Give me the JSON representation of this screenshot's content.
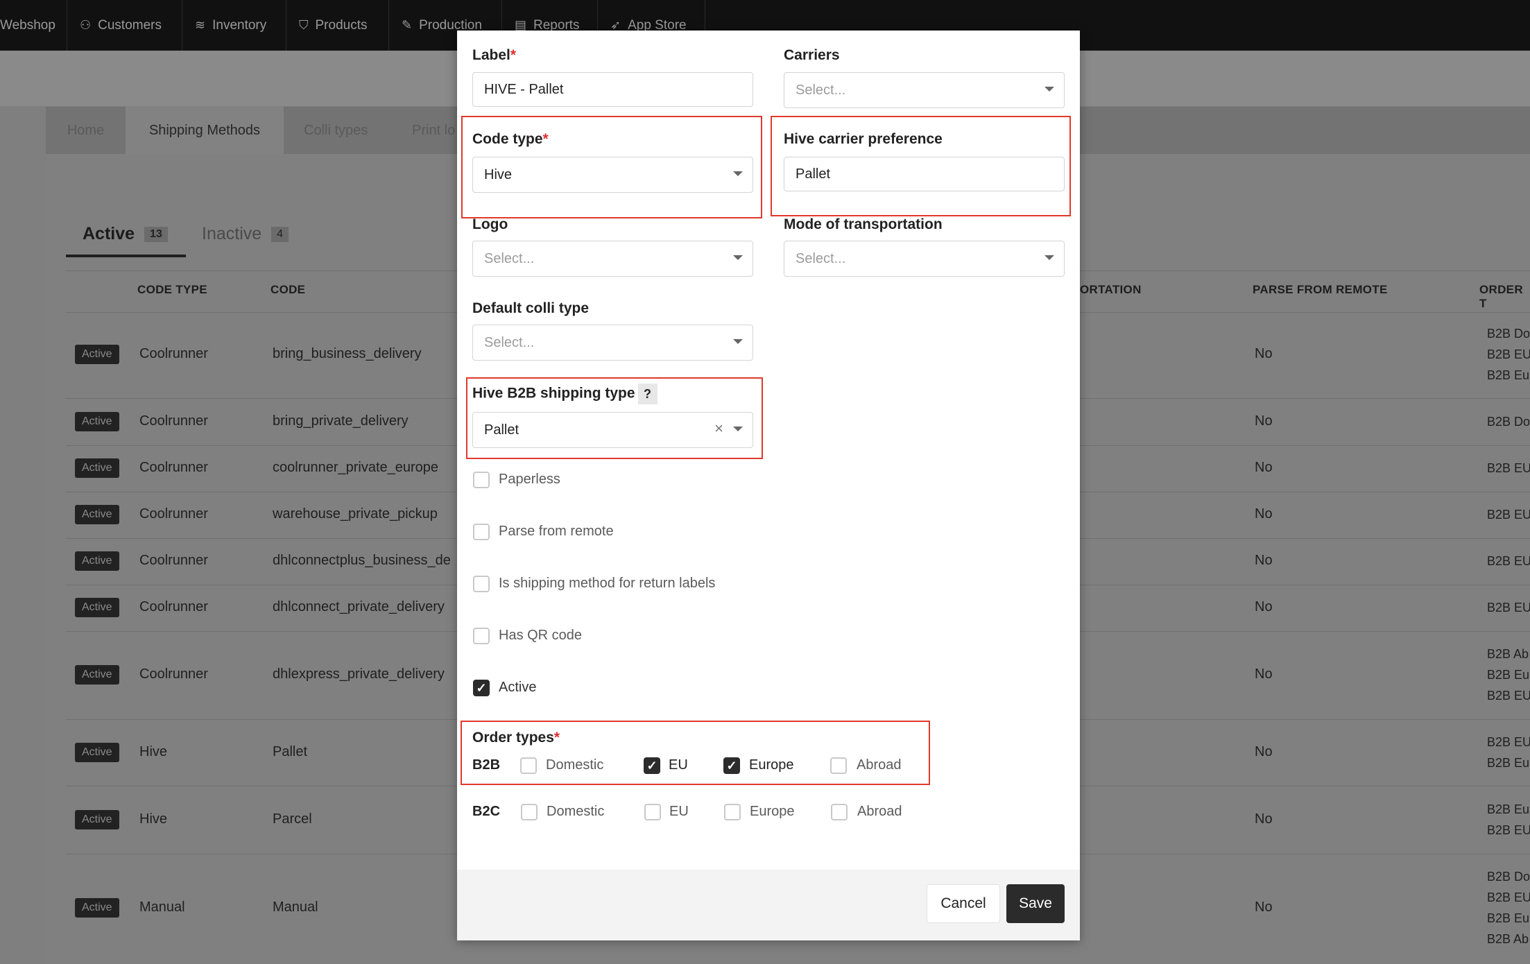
{
  "nav": {
    "items": [
      {
        "label": "Webshop",
        "icon": ""
      },
      {
        "label": "Customers",
        "icon": "users-icon"
      },
      {
        "label": "Inventory",
        "icon": "layers-icon"
      },
      {
        "label": "Products",
        "icon": "shirt-icon"
      },
      {
        "label": "Production",
        "icon": "pencil-icon"
      },
      {
        "label": "Reports",
        "icon": "chart-icon"
      },
      {
        "label": "App Store",
        "icon": "rocket-icon"
      }
    ]
  },
  "settings_tabs": [
    "Home",
    "Shipping Methods",
    "Colli types",
    "Print lo"
  ],
  "status_tabs": {
    "active_label": "Active",
    "active_count": "13",
    "inactive_label": "Inactive",
    "inactive_count": "4"
  },
  "table": {
    "headers": {
      "code_type": "CODE TYPE",
      "code": "CODE",
      "transport": "ORTATION",
      "parse": "PARSE FROM REMOTE",
      "order": "ORDER T"
    },
    "rows": [
      {
        "status": "Active",
        "code_type": "Coolrunner",
        "code": "bring_business_delivery",
        "parse": "No",
        "order_types": [
          "B2B Do",
          "B2B EU",
          "B2B Eu"
        ]
      },
      {
        "status": "Active",
        "code_type": "Coolrunner",
        "code": "bring_private_delivery",
        "parse": "No",
        "order_types": [
          "B2B Do"
        ]
      },
      {
        "status": "Active",
        "code_type": "Coolrunner",
        "code": "coolrunner_private_europe",
        "parse": "No",
        "order_types": [
          "B2B EU"
        ]
      },
      {
        "status": "Active",
        "code_type": "Coolrunner",
        "code": "warehouse_private_pickup",
        "parse": "No",
        "order_types": [
          "B2B EU"
        ]
      },
      {
        "status": "Active",
        "code_type": "Coolrunner",
        "code": "dhlconnectplus_business_de",
        "parse": "No",
        "order_types": [
          "B2B EU"
        ]
      },
      {
        "status": "Active",
        "code_type": "Coolrunner",
        "code": "dhlconnect_private_delivery",
        "parse": "No",
        "order_types": [
          "B2B EU"
        ]
      },
      {
        "status": "Active",
        "code_type": "Coolrunner",
        "code": "dhlexpress_private_delivery",
        "parse": "No",
        "order_types": [
          "B2B Ab",
          "B2B Eu",
          "B2B EU"
        ]
      },
      {
        "status": "Active",
        "code_type": "Hive",
        "code": "Pallet",
        "parse": "No",
        "order_types": [
          "B2B EU",
          "B2B Eu"
        ]
      },
      {
        "status": "Active",
        "code_type": "Hive",
        "code": "Parcel",
        "parse": "No",
        "order_types": [
          "B2B Eu",
          "B2B EU"
        ]
      },
      {
        "status": "Active",
        "code_type": "Manual",
        "code": "Manual",
        "parse": "No",
        "order_types": [
          "B2B Do",
          "B2B EU",
          "B2B Eu",
          "B2B Ab"
        ]
      }
    ]
  },
  "modal": {
    "label": {
      "title": "Label",
      "req": "*",
      "value": "HIVE - Pallet"
    },
    "carriers": {
      "title": "Carriers",
      "placeholder": "Select..."
    },
    "code_type": {
      "title": "Code type",
      "req": "*",
      "value": "Hive"
    },
    "hive_carrier_preference": {
      "title": "Hive carrier preference",
      "value": "Pallet"
    },
    "logo": {
      "title": "Logo",
      "placeholder": "Select..."
    },
    "mode_of_transportation": {
      "title": "Mode of transportation",
      "placeholder": "Select..."
    },
    "default_colli_type": {
      "title": "Default colli type",
      "placeholder": "Select..."
    },
    "hive_b2b_shipping_type": {
      "title": "Hive B2B shipping type",
      "help": "?",
      "value": "Pallet",
      "clear": "×"
    },
    "checkboxes": [
      {
        "label": "Paperless",
        "checked": false
      },
      {
        "label": "Parse from remote",
        "checked": false
      },
      {
        "label": "Is shipping method for return labels",
        "checked": false
      },
      {
        "label": "Has QR code",
        "checked": false
      },
      {
        "label": "Active",
        "checked": true
      }
    ],
    "order_types": {
      "title": "Order types",
      "req": "*",
      "b2b": {
        "label": "B2B",
        "options": [
          {
            "label": "Domestic",
            "checked": false
          },
          {
            "label": "EU",
            "checked": true
          },
          {
            "label": "Europe",
            "checked": true
          },
          {
            "label": "Abroad",
            "checked": false
          }
        ]
      },
      "b2c": {
        "label": "B2C",
        "options": [
          {
            "label": "Domestic",
            "checked": false
          },
          {
            "label": "EU",
            "checked": false
          },
          {
            "label": "Europe",
            "checked": false
          },
          {
            "label": "Abroad",
            "checked": false
          }
        ]
      }
    },
    "cancel_label": "Cancel",
    "save_label": "Save",
    "check_glyph": "✓"
  },
  "colors": {
    "accent_dark": "#2b2b2b",
    "highlight_red": "#e0392b",
    "required_red": "#e03131"
  }
}
